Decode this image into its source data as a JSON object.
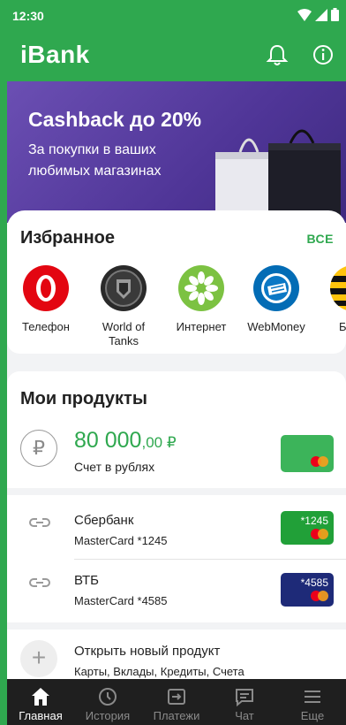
{
  "status_bar": {
    "time": "12:30"
  },
  "app_bar": {
    "title": "iBank"
  },
  "promo": {
    "title": "Cashback до 20%",
    "subtitle": "За покупки в ваших любимых магазинах"
  },
  "favorites": {
    "title": "Избранное",
    "all_label": "ВСЕ",
    "items": [
      {
        "label": "Телефон",
        "icon": "mts-logo-icon",
        "color": "#e30611"
      },
      {
        "label": "World of Tanks",
        "icon": "world-of-tanks-icon",
        "color": "#2a2a2a"
      },
      {
        "label": "Интернет",
        "icon": "internet-provider-icon",
        "color": "#7cc242"
      },
      {
        "label": "WebMoney",
        "icon": "webmoney-icon",
        "color": "#036cb5"
      },
      {
        "label": "Би",
        "icon": "beeline-icon",
        "color": "#ffc40c"
      }
    ]
  },
  "products": {
    "title": "Мои продукты",
    "account": {
      "amount_main": "80 000",
      "amount_kop": ",00 ₽",
      "label": "Счет в рублях",
      "card_color": "#3cb45a"
    },
    "cards": [
      {
        "bank": "Сбербанк",
        "number": "MasterCard *1245",
        "card_tag": "*1245",
        "card_color": "#21a038"
      },
      {
        "bank": "ВТБ",
        "number": "MasterCard *4585",
        "card_tag": "*4585",
        "card_color": "#1e2a78"
      }
    ],
    "new_product": {
      "title": "Открыть новый продукт",
      "subtitle": "Карты, Вклады, Кредиты, Счета"
    }
  },
  "bottom_nav": {
    "items": [
      {
        "label": "Главная",
        "icon": "home-icon",
        "active": true
      },
      {
        "label": "История",
        "icon": "clock-icon",
        "active": false
      },
      {
        "label": "Платежи",
        "icon": "transfer-icon",
        "active": false
      },
      {
        "label": "Чат",
        "icon": "chat-icon",
        "active": false
      },
      {
        "label": "Еще",
        "icon": "menu-icon",
        "active": false
      }
    ]
  },
  "colors": {
    "brand_green": "#2fa84f",
    "promo_purple": "#5a3fa5",
    "nav_dark": "#1f1f1f"
  }
}
